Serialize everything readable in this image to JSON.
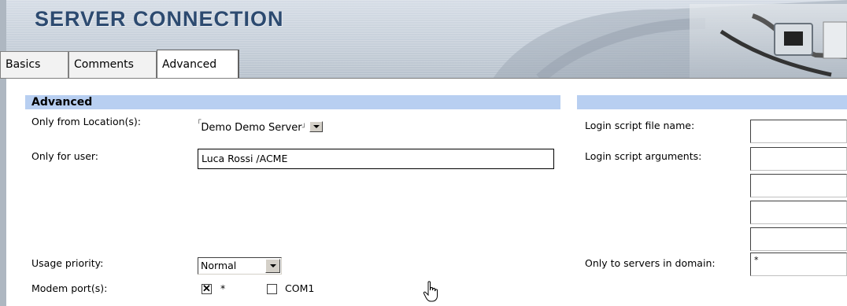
{
  "header": {
    "title": "SERVER CONNECTION"
  },
  "tabs": [
    {
      "label": "Basics",
      "active": false
    },
    {
      "label": "Comments",
      "active": false
    },
    {
      "label": "Advanced",
      "active": true
    }
  ],
  "section": {
    "title": "Advanced"
  },
  "left_fields": {
    "location": {
      "label": "Only from Location(s):",
      "value": "Demo Demo Server"
    },
    "user": {
      "label": "Only for user:",
      "value": "Luca Rossi /ACME"
    },
    "priority": {
      "label": "Usage priority:",
      "value": "Normal"
    },
    "modem": {
      "label": "Modem port(s):",
      "options": [
        {
          "label": "*",
          "checked": true
        },
        {
          "label": "COM1",
          "checked": false
        }
      ]
    }
  },
  "right_fields": {
    "login_script_file": {
      "label": "Login script file name:",
      "value": ""
    },
    "login_script_args": {
      "label": "Login script arguments:",
      "values": [
        "",
        "",
        "",
        ""
      ]
    },
    "domain": {
      "label": "Only to servers in domain:",
      "value": "*"
    }
  },
  "colors": {
    "title": "#2c4a70",
    "section_bar": "#b8cff1",
    "header_bg": "#c7d0da"
  }
}
